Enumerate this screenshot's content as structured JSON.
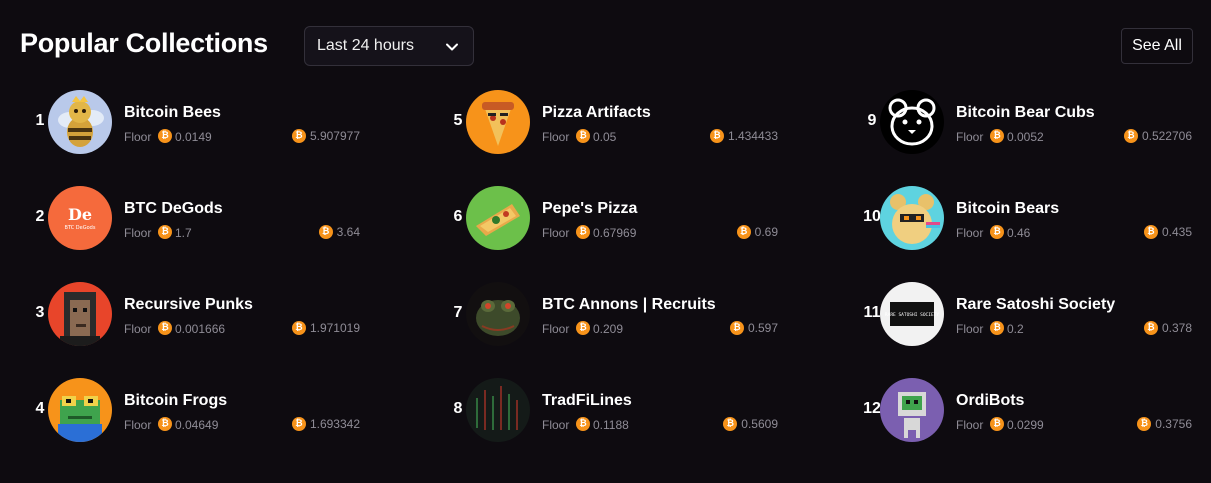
{
  "header": {
    "title": "Popular Collections",
    "period": "Last 24 hours",
    "see_all": "See All"
  },
  "currency_glyph": "₿",
  "collections": [
    {
      "rank": "1",
      "name": "Bitcoin Bees",
      "floor_label": "Floor",
      "floor": "0.0149",
      "volume": "5.907977"
    },
    {
      "rank": "2",
      "name": "BTC DeGods",
      "floor_label": "Floor",
      "floor": "1.7",
      "volume": "3.64",
      "avatar_text": "De",
      "avatar_subtext": "BTC DeGods"
    },
    {
      "rank": "3",
      "name": "Recursive Punks",
      "floor_label": "Floor",
      "floor": "0.001666",
      "volume": "1.971019"
    },
    {
      "rank": "4",
      "name": "Bitcoin Frogs",
      "floor_label": "Floor",
      "floor": "0.04649",
      "volume": "1.693342"
    },
    {
      "rank": "5",
      "name": "Pizza Artifacts",
      "floor_label": "Floor",
      "floor": "0.05",
      "volume": "1.434433"
    },
    {
      "rank": "6",
      "name": "Pepe's Pizza",
      "floor_label": "Floor",
      "floor": "0.67969",
      "volume": "0.69"
    },
    {
      "rank": "7",
      "name": "BTC Annons | Recruits",
      "floor_label": "Floor",
      "floor": "0.209",
      "volume": "0.597"
    },
    {
      "rank": "8",
      "name": "TradFiLines",
      "floor_label": "Floor",
      "floor": "0.1188",
      "volume": "0.5609"
    },
    {
      "rank": "9",
      "name": "Bitcoin Bear Cubs",
      "floor_label": "Floor",
      "floor": "0.0052",
      "volume": "0.522706"
    },
    {
      "rank": "10",
      "name": "Bitcoin Bears",
      "floor_label": "Floor",
      "floor": "0.46",
      "volume": "0.435"
    },
    {
      "rank": "11",
      "name": "Rare Satoshi Society",
      "floor_label": "Floor",
      "floor": "0.2",
      "volume": "0.378",
      "avatar_text": "RARE SATOSHI SOCIETY"
    },
    {
      "rank": "12",
      "name": "OrdiBots",
      "floor_label": "Floor",
      "floor": "0.0299",
      "volume": "0.3756"
    }
  ],
  "colors": {
    "background": "#0e0b10",
    "coin": "#f7931a",
    "muted_text": "#8f8c96"
  }
}
